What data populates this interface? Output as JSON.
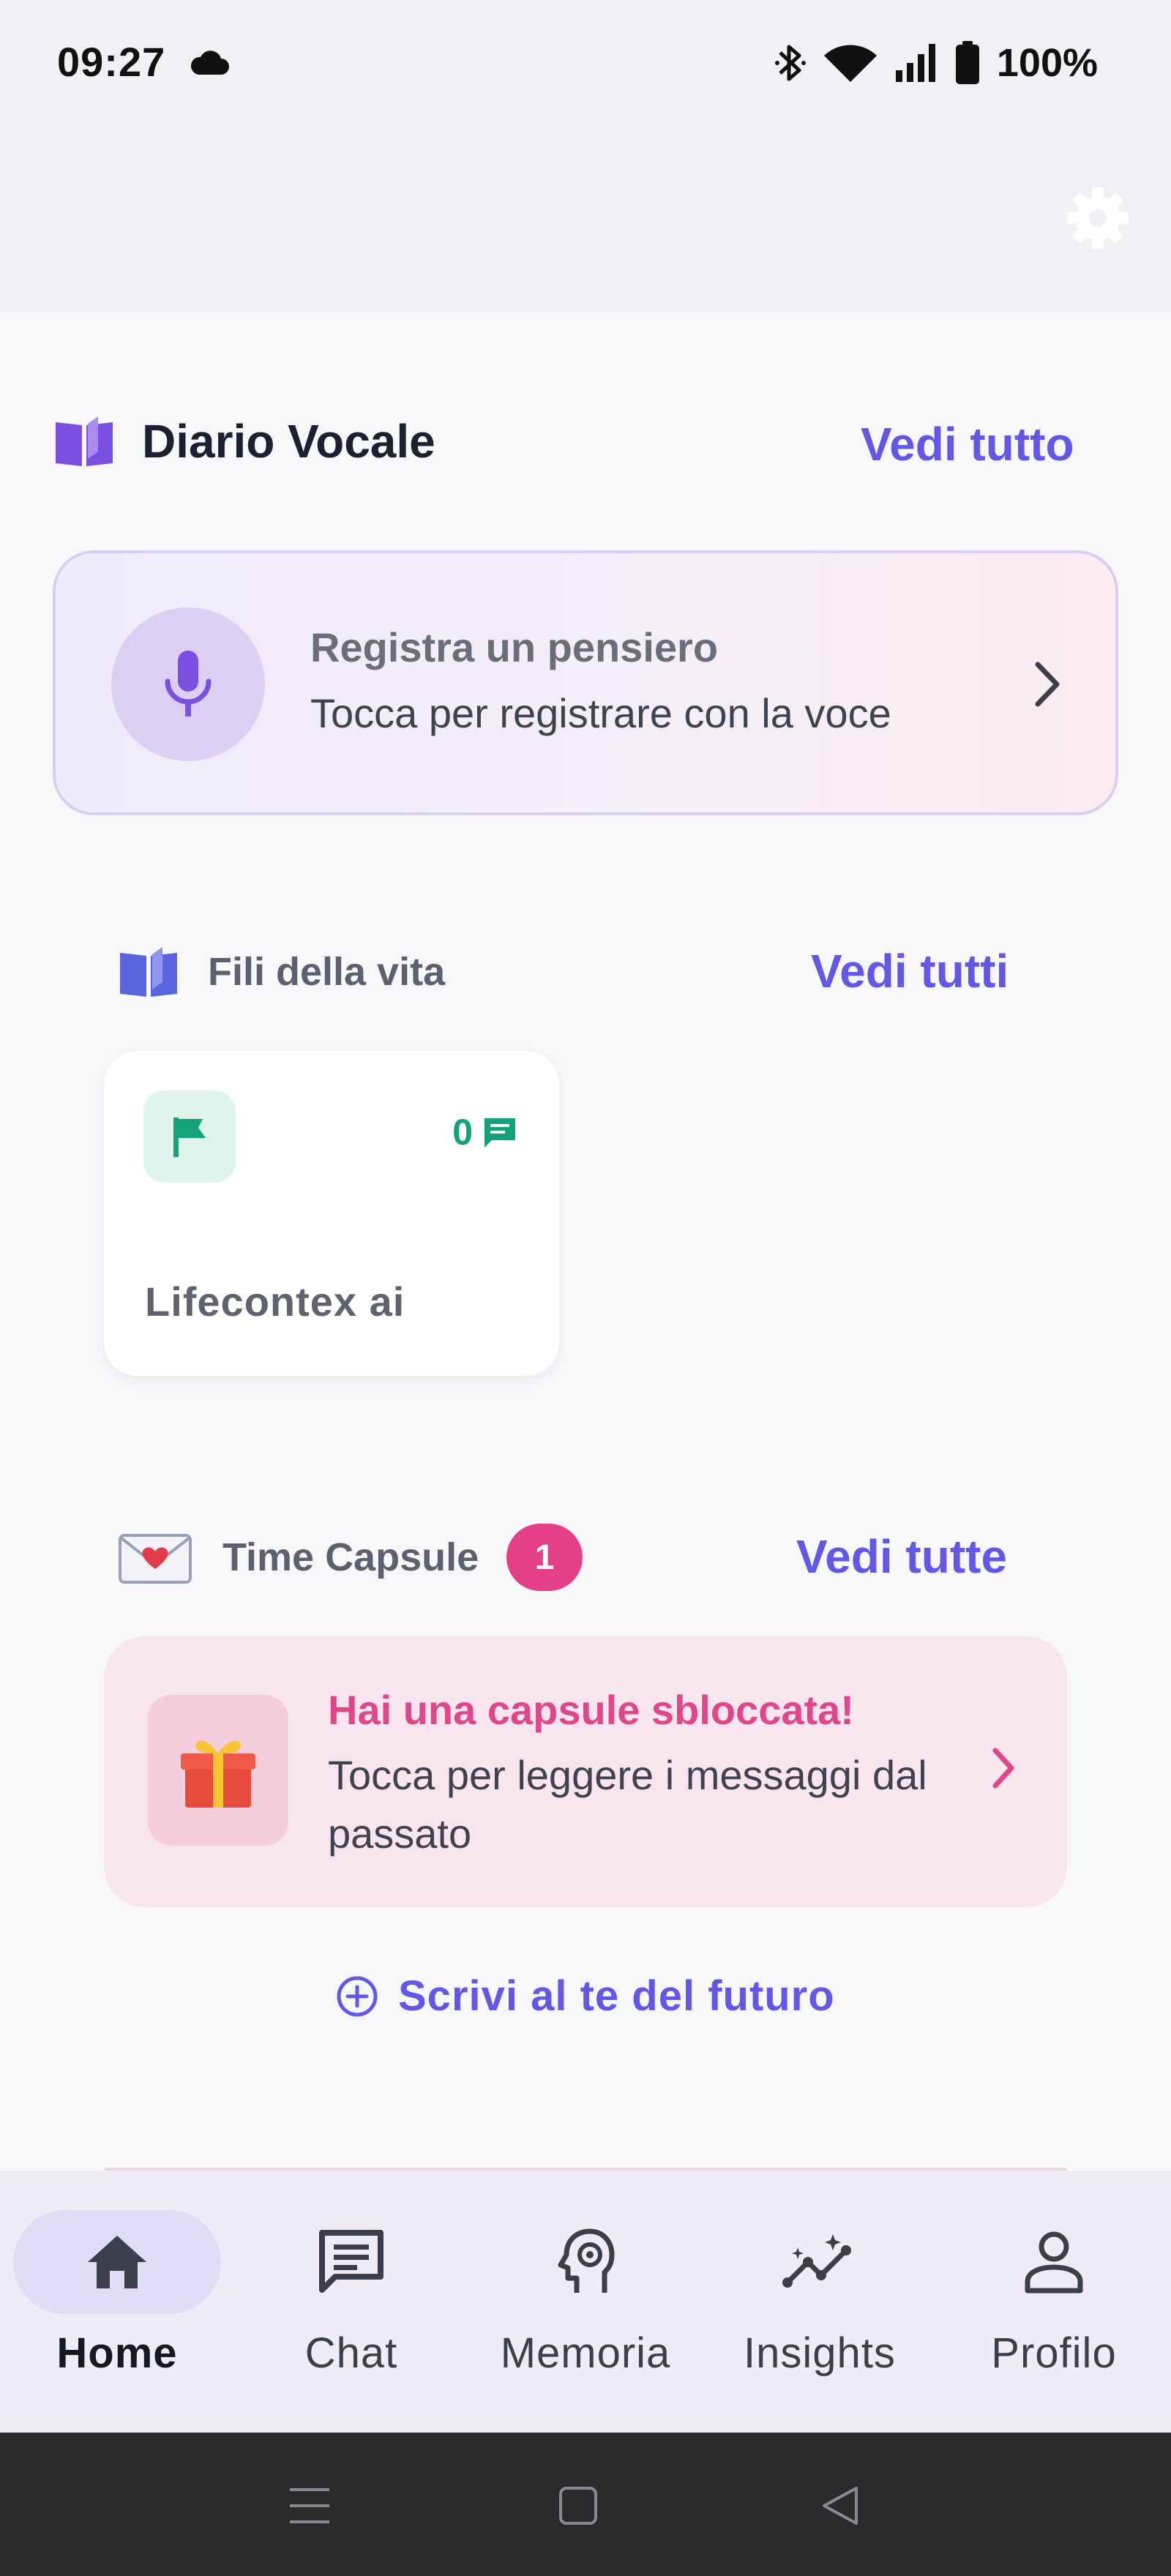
{
  "status_bar": {
    "time": "09:27",
    "battery": "100%"
  },
  "header": {
    "settings_icon": "gear-icon"
  },
  "voice_diary": {
    "title": "Diario Vocale",
    "see_all": "Vedi tutto",
    "record_title": "Registra un pensiero",
    "record_subtitle": "Tocca per registrare con la voce"
  },
  "life_threads": {
    "title": "Fili della vita",
    "see_all": "Vedi tutti",
    "card": {
      "count": "0",
      "name": "Lifecontex ai"
    }
  },
  "time_capsule": {
    "title": "Time Capsule",
    "badge": "1",
    "see_all": "Vedi tutte",
    "card_title": "Hai una capsule sbloccata!",
    "card_subtitle": "Tocca per leggere i messaggi dal passato",
    "write_future": "Scrivi al te del futuro"
  },
  "bottom_nav": {
    "items": [
      {
        "label": "Home",
        "icon": "home-icon",
        "active": true
      },
      {
        "label": "Chat",
        "icon": "chat-icon",
        "active": false
      },
      {
        "label": "Memoria",
        "icon": "brain-icon",
        "active": false
      },
      {
        "label": "Insights",
        "icon": "insights-icon",
        "active": false
      },
      {
        "label": "Profilo",
        "icon": "person-icon",
        "active": false
      }
    ]
  },
  "colors": {
    "accent": "#6357e6",
    "pink": "#e0478b",
    "green": "#13a37a"
  }
}
